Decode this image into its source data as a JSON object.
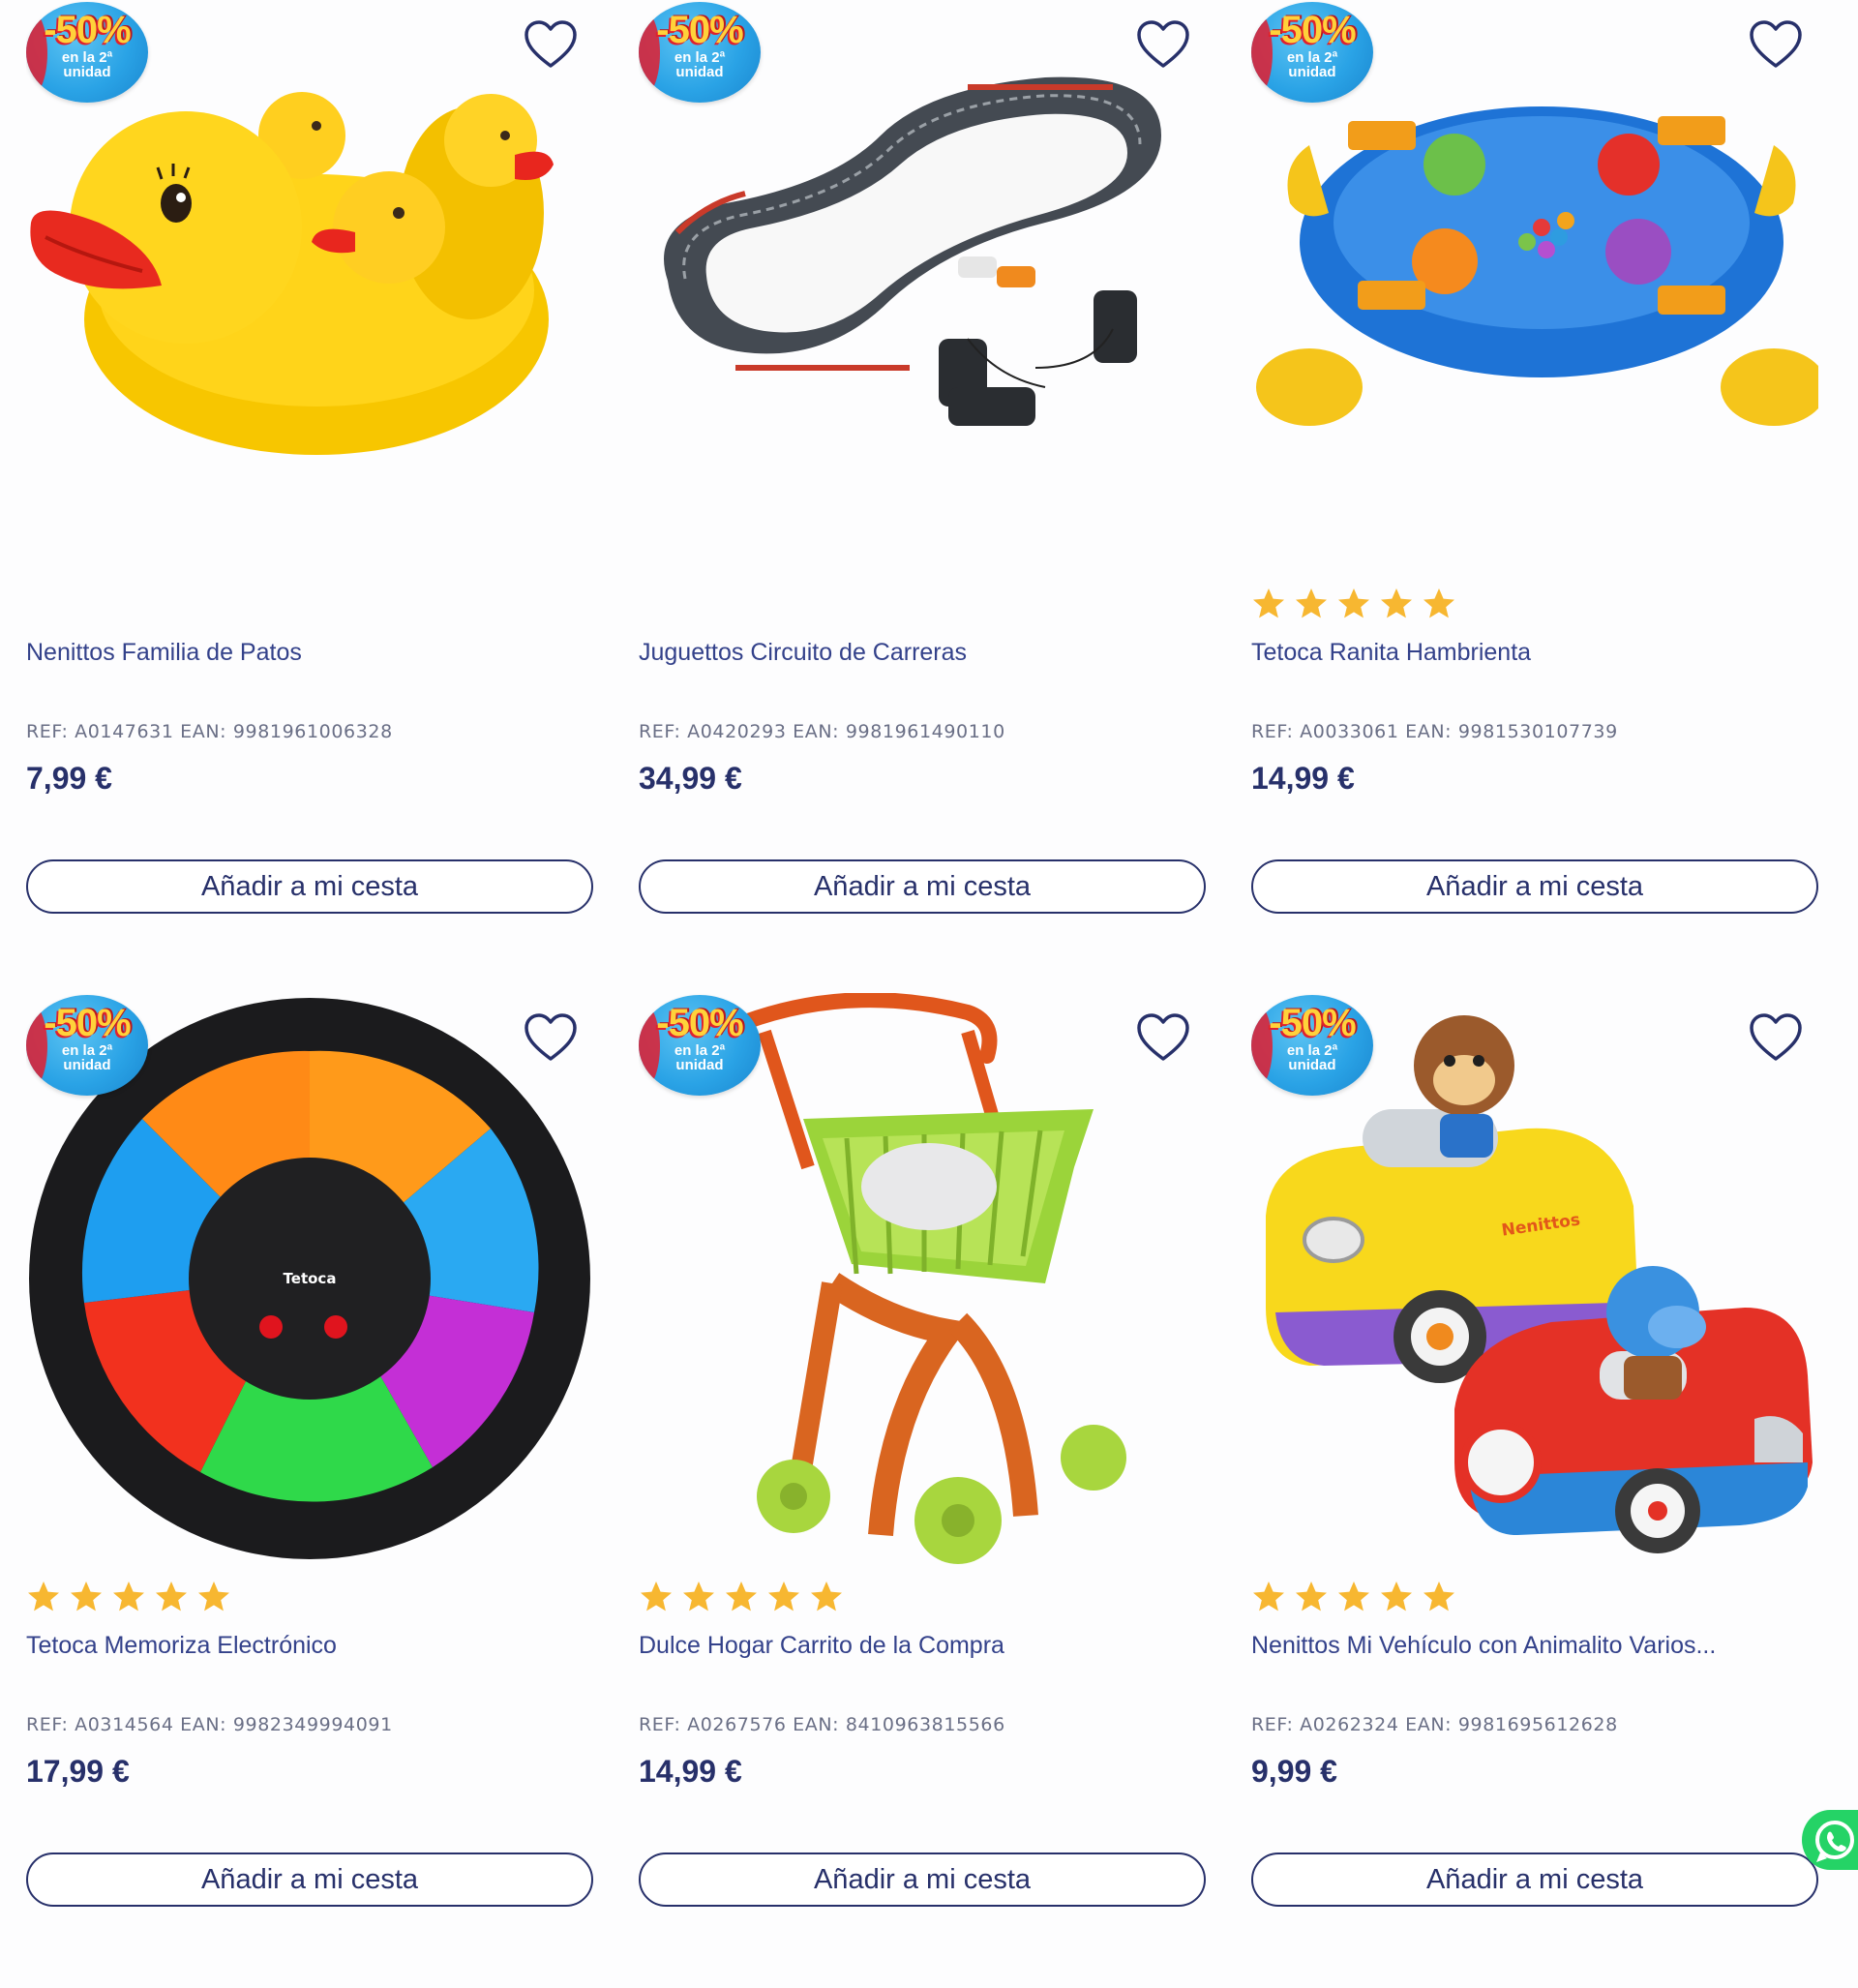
{
  "colors": {
    "brand_navy": "#27306a",
    "badge_blue": "#2aa3e6",
    "badge_yellow": "#ffd23a",
    "star": "#f7b731",
    "whatsapp": "#25d366"
  },
  "products": [
    {
      "name": "Nenittos Familia de Patos",
      "ref": "REF: A0147631 EAN: 9981961006328",
      "price": "7,99 €",
      "button": "Añadir a mi cesta",
      "badge": {
        "main": "-50%",
        "sub1": "en la 2ª",
        "sub2": "unidad"
      },
      "rating": 0,
      "image_icon": "rubber-ducks"
    },
    {
      "name": "Juguettos Circuito de Carreras",
      "ref": "REF: A0420293 EAN: 9981961490110",
      "price": "34,99 €",
      "button": "Añadir a mi cesta",
      "badge": {
        "main": "-50%",
        "sub1": "en la 2ª",
        "sub2": "unidad"
      },
      "rating": 0,
      "image_icon": "race-track"
    },
    {
      "name": "Tetoca Ranita Hambrienta",
      "ref": "REF: A0033061 EAN: 9981530107739",
      "price": "14,99 €",
      "button": "Añadir a mi cesta",
      "badge": {
        "main": "-50%",
        "sub1": "en la 2ª",
        "sub2": "unidad"
      },
      "rating": 5,
      "image_icon": "hungry-frogs-game"
    },
    {
      "name": "Tetoca Memoriza Electrónico",
      "ref": "REF: A0314564 EAN: 9982349994091",
      "price": "17,99 €",
      "button": "Añadir a mi cesta",
      "badge": {
        "main": "-50%",
        "sub1": "en la 2ª",
        "sub2": "unidad"
      },
      "rating": 5,
      "image_icon": "memory-game",
      "image_text": "Tetoca"
    },
    {
      "name": "Dulce Hogar Carrito de la Compra",
      "ref": "REF: A0267576 EAN: 8410963815566",
      "price": "14,99 €",
      "button": "Añadir a mi cesta",
      "badge": {
        "main": "-50%",
        "sub1": "en la 2ª",
        "sub2": "unidad"
      },
      "rating": 5,
      "image_icon": "shopping-cart-toy"
    },
    {
      "name": "Nenittos Mi Vehículo con Animalito Varios...",
      "ref": "REF: A0262324 EAN: 9981695612628",
      "price": "9,99 €",
      "button": "Añadir a mi cesta",
      "badge": {
        "main": "-50%",
        "sub1": "en la 2ª",
        "sub2": "unidad"
      },
      "rating": 5,
      "image_icon": "animal-cars",
      "image_text": "Nenittos"
    }
  ]
}
